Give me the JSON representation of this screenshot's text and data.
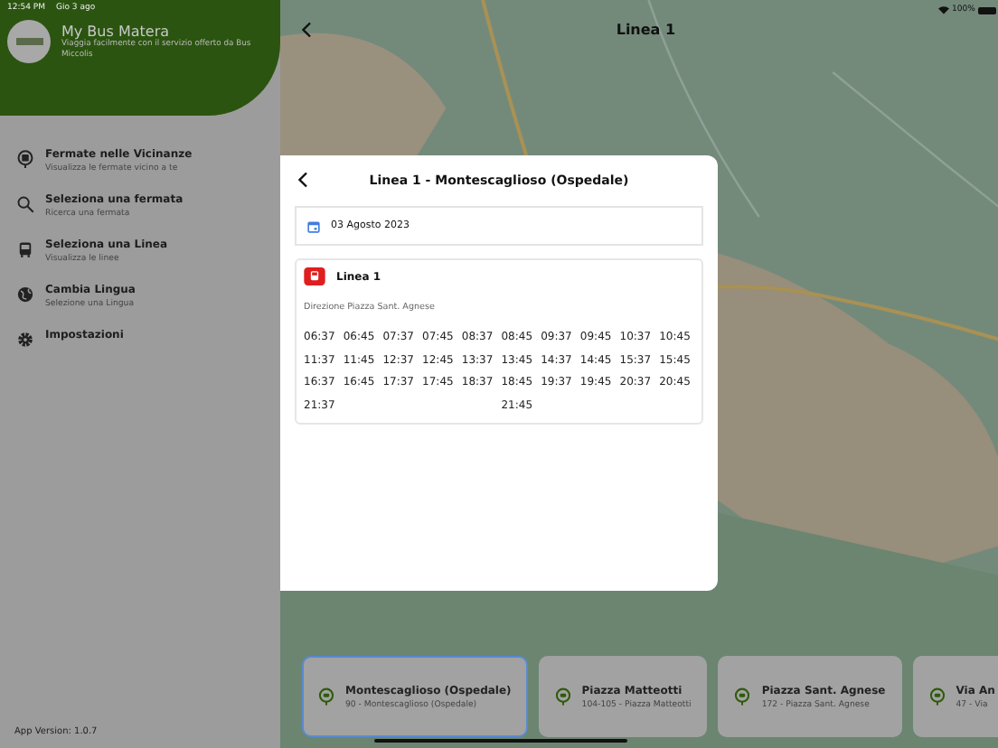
{
  "status_bar": {
    "time": "12:54 PM",
    "date": "Gio 3 ago",
    "battery": "100%"
  },
  "app": {
    "name": "My Bus Matera",
    "tagline": "Viaggia facilmente con il servizio offerto da Bus Miccolis"
  },
  "menu": [
    {
      "title": "Fermate nelle Vicinanze",
      "subtitle": "Visualizza le fermate vicino a te",
      "kind": "stop"
    },
    {
      "title": "Seleziona una fermata",
      "subtitle": "Ricerca una fermata",
      "kind": "search"
    },
    {
      "title": "Seleziona una Linea",
      "subtitle": "Visualizza le linee",
      "kind": "bus"
    },
    {
      "title": "Cambia Lingua",
      "subtitle": "Selezione una Lingua",
      "kind": "globe"
    },
    {
      "title": "Impostazioni",
      "kind": "gear"
    }
  ],
  "version": "App Version: 1.0.7",
  "header": {
    "title": "Linea 1"
  },
  "dialog": {
    "title": "Linea 1 - Montescaglioso (Ospedale)",
    "date": "03 Agosto 2023",
    "line": "Linea 1",
    "direction": "Direzione Piazza Sant. Agnese",
    "columns": [
      [
        "06:37",
        "11:37",
        "16:37",
        "21:37"
      ],
      [
        "06:45",
        "11:45",
        "16:45"
      ],
      [
        "07:37",
        "12:37",
        "17:37"
      ],
      [
        "07:45",
        "12:45",
        "17:45"
      ],
      [
        "08:37",
        "13:37",
        "18:37"
      ],
      [
        "08:45",
        "13:45",
        "18:45",
        "21:45"
      ],
      [
        "09:37",
        "14:37",
        "19:37"
      ],
      [
        "09:45",
        "14:45",
        "19:45"
      ],
      [
        "10:37",
        "15:37",
        "20:37"
      ],
      [
        "10:45",
        "15:45",
        "20:45"
      ]
    ]
  },
  "stops": [
    {
      "name": "Montescaglioso (Ospedale)",
      "detail": "90 - Montescaglioso (Ospedale)",
      "selected": true
    },
    {
      "name": "Piazza Matteotti",
      "detail": "104-105 - Piazza Matteotti",
      "selected": false
    },
    {
      "name": "Piazza Sant. Agnese",
      "detail": "172 - Piazza Sant. Agnese",
      "selected": false
    },
    {
      "name": "Via An",
      "detail": "47 - Via",
      "selected": false
    }
  ]
}
